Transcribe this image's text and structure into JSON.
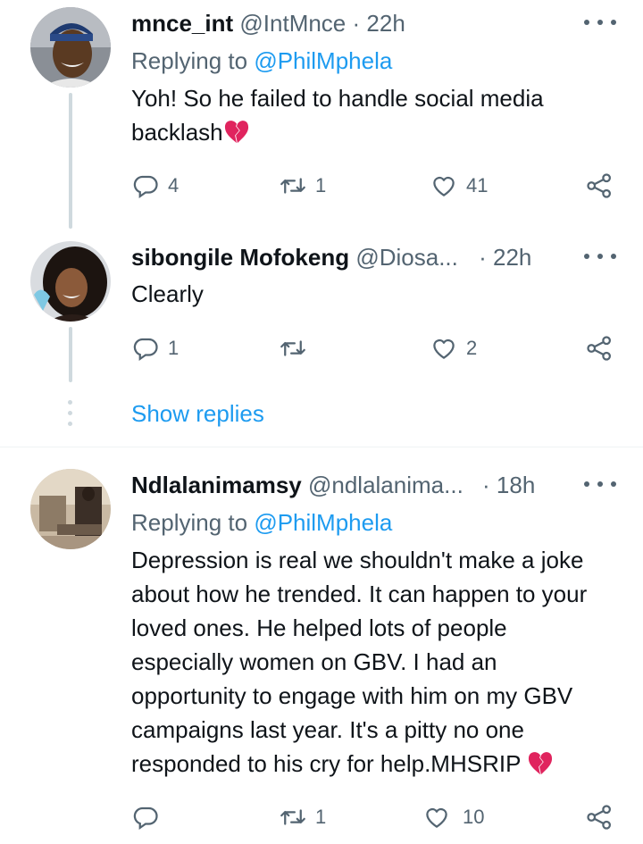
{
  "tweets": [
    {
      "name": "mnce_int",
      "handle": "@IntMnce",
      "time": "· 22h",
      "replying_prefix": "Replying to ",
      "replying_to": "@PhilMphela",
      "text": "Yoh! So he failed to handle social media backlash",
      "emoji": "broken-heart",
      "replies": "4",
      "retweets": "1",
      "likes": "41"
    },
    {
      "name": "sibongile Mofokeng",
      "handle": "@Diosa...",
      "time": "· 22h",
      "text": "Clearly",
      "replies": "1",
      "retweets": "",
      "likes": "2"
    },
    {
      "name": "Ndlalanimamsy",
      "handle": "@ndlalanima...",
      "time": "· 18h",
      "replying_prefix": "Replying to ",
      "replying_to": "@PhilMphela",
      "text": "Depression is real we shouldn't make a joke about how he trended. It can happen to your loved ones. He helped lots of people especially women on GBV. I had an opportunity to engage with him on my GBV campaigns last year. It's a pitty no one responded to his cry for help.MHSRIP",
      "emoji": "broken-heart",
      "replies": "",
      "retweets": "1",
      "likes": "10"
    }
  ],
  "show_replies": "Show replies",
  "colors": {
    "link": "#1d9bf0",
    "secondary": "#536471",
    "primary": "#0f1419",
    "thread_line": "#cfd9de",
    "broken_heart": "#e0245e"
  },
  "icons": [
    "reply-icon",
    "retweet-icon",
    "like-icon",
    "share-icon",
    "more-icon",
    "broken-heart-emoji"
  ]
}
